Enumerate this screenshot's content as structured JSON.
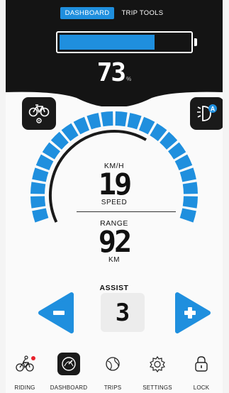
{
  "colors": {
    "accent": "#1f8fde",
    "dark": "#141414",
    "alert": "#e8212b"
  },
  "tabs": [
    {
      "label": "DASHBOARD",
      "active": true
    },
    {
      "label": "TRIP TOOLS",
      "active": false
    }
  ],
  "battery": {
    "percent": 73,
    "unit": "%"
  },
  "speed": {
    "label": "KM/H",
    "value": "19",
    "caption": "SPEED"
  },
  "range": {
    "label": "RANGE",
    "value": "92",
    "unit": "KM"
  },
  "assist": {
    "label": "ASSIST",
    "level": "3"
  },
  "corner": {
    "left_icon": "bike-settings-icon",
    "right_icon": "headlight-auto-icon",
    "right_badge": "A"
  },
  "nav": [
    {
      "label": "RIDING",
      "icon": "bike-riding-icon",
      "notification": true
    },
    {
      "label": "DASHBOARD",
      "icon": "dashboard-gauge-icon",
      "active": true
    },
    {
      "label": "TRIPS",
      "icon": "globe-route-icon"
    },
    {
      "label": "SETTINGS",
      "icon": "gear-icon"
    },
    {
      "label": "LOCK",
      "icon": "padlock-icon"
    }
  ]
}
